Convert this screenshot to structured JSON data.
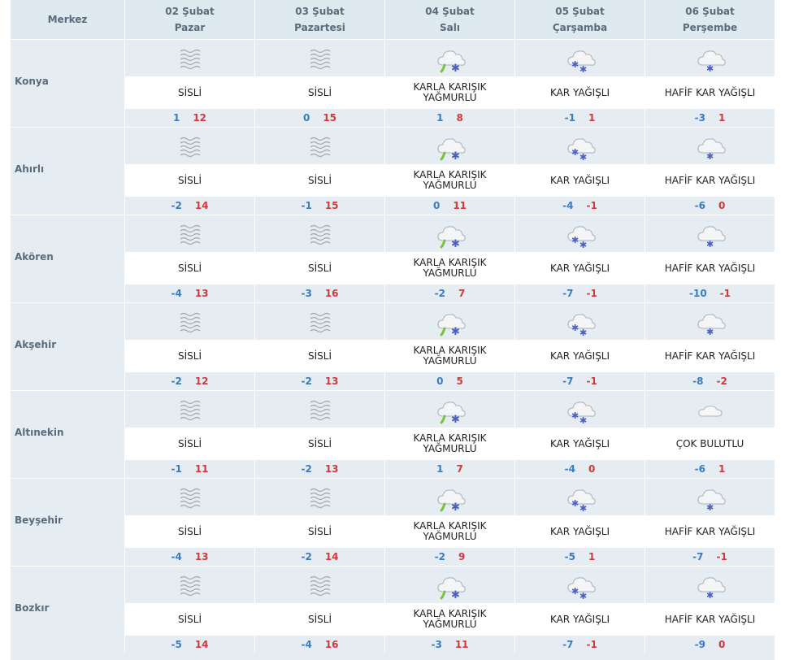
{
  "header": {
    "location_label": "Merkez",
    "days": [
      {
        "date": "02 Şubat",
        "weekday": "Pazar"
      },
      {
        "date": "03 Şubat",
        "weekday": "Pazartesi"
      },
      {
        "date": "04 Şubat",
        "weekday": "Salı"
      },
      {
        "date": "05 Şubat",
        "weekday": "Çarşamba"
      },
      {
        "date": "06 Şubat",
        "weekday": "Perşembe"
      }
    ]
  },
  "icon_colors": {
    "cloud": "#b9bec4",
    "fog": "#a9aeb4",
    "rain": "#7cc242",
    "snow": "#4b5fc4",
    "sun_bg": "#e5edf2"
  },
  "rows": [
    {
      "name": "Konya",
      "days": [
        {
          "icon": "fog-icon",
          "desc": "SİSLİ",
          "lo": "1",
          "hi": "12"
        },
        {
          "icon": "fog-icon",
          "desc": "SİSLİ",
          "lo": "0",
          "hi": "15"
        },
        {
          "icon": "sleet-icon",
          "desc": "KARLA KARIŞIK YAĞMURLU",
          "lo": "1",
          "hi": "8"
        },
        {
          "icon": "snow-icon",
          "desc": "KAR YAĞIŞLI",
          "lo": "-1",
          "hi": "1"
        },
        {
          "icon": "light-snow-icon",
          "desc": "HAFİF KAR YAĞIŞLI",
          "lo": "-3",
          "hi": "1"
        }
      ]
    },
    {
      "name": "Ahırlı",
      "days": [
        {
          "icon": "fog-icon",
          "desc": "SİSLİ",
          "lo": "-2",
          "hi": "14"
        },
        {
          "icon": "fog-icon",
          "desc": "SİSLİ",
          "lo": "-1",
          "hi": "15"
        },
        {
          "icon": "sleet-icon",
          "desc": "KARLA KARIŞIK YAĞMURLU",
          "lo": "0",
          "hi": "11"
        },
        {
          "icon": "snow-icon",
          "desc": "KAR YAĞIŞLI",
          "lo": "-4",
          "hi": "-1"
        },
        {
          "icon": "light-snow-icon",
          "desc": "HAFİF KAR YAĞIŞLI",
          "lo": "-6",
          "hi": "0"
        }
      ]
    },
    {
      "name": "Akören",
      "days": [
        {
          "icon": "fog-icon",
          "desc": "SİSLİ",
          "lo": "-4",
          "hi": "13"
        },
        {
          "icon": "fog-icon",
          "desc": "SİSLİ",
          "lo": "-3",
          "hi": "16"
        },
        {
          "icon": "sleet-icon",
          "desc": "KARLA KARIŞIK YAĞMURLU",
          "lo": "-2",
          "hi": "7"
        },
        {
          "icon": "snow-icon",
          "desc": "KAR YAĞIŞLI",
          "lo": "-7",
          "hi": "-1"
        },
        {
          "icon": "light-snow-icon",
          "desc": "HAFİF KAR YAĞIŞLI",
          "lo": "-10",
          "hi": "-1"
        }
      ]
    },
    {
      "name": "Akşehir",
      "days": [
        {
          "icon": "fog-icon",
          "desc": "SİSLİ",
          "lo": "-2",
          "hi": "12"
        },
        {
          "icon": "fog-icon",
          "desc": "SİSLİ",
          "lo": "-2",
          "hi": "13"
        },
        {
          "icon": "sleet-icon",
          "desc": "KARLA KARIŞIK YAĞMURLU",
          "lo": "0",
          "hi": "5"
        },
        {
          "icon": "snow-icon",
          "desc": "KAR YAĞIŞLI",
          "lo": "-7",
          "hi": "-1"
        },
        {
          "icon": "light-snow-icon",
          "desc": "HAFİF KAR YAĞIŞLI",
          "lo": "-8",
          "hi": "-2"
        }
      ]
    },
    {
      "name": "Altınekin",
      "days": [
        {
          "icon": "fog-icon",
          "desc": "SİSLİ",
          "lo": "-1",
          "hi": "11"
        },
        {
          "icon": "fog-icon",
          "desc": "SİSLİ",
          "lo": "-2",
          "hi": "13"
        },
        {
          "icon": "sleet-icon",
          "desc": "KARLA KARIŞIK YAĞMURLU",
          "lo": "1",
          "hi": "7"
        },
        {
          "icon": "snow-icon",
          "desc": "KAR YAĞIŞLI",
          "lo": "-4",
          "hi": "0"
        },
        {
          "icon": "cloudy-icon",
          "desc": "ÇOK BULUTLU",
          "lo": "-6",
          "hi": "1"
        }
      ]
    },
    {
      "name": "Beyşehir",
      "days": [
        {
          "icon": "fog-icon",
          "desc": "SİSLİ",
          "lo": "-4",
          "hi": "13"
        },
        {
          "icon": "fog-icon",
          "desc": "SİSLİ",
          "lo": "-2",
          "hi": "14"
        },
        {
          "icon": "sleet-icon",
          "desc": "KARLA KARIŞIK YAĞMURLU",
          "lo": "-2",
          "hi": "9"
        },
        {
          "icon": "snow-icon",
          "desc": "KAR YAĞIŞLI",
          "lo": "-5",
          "hi": "1"
        },
        {
          "icon": "light-snow-icon",
          "desc": "HAFİF KAR YAĞIŞLI",
          "lo": "-7",
          "hi": "-1"
        }
      ]
    },
    {
      "name": "Bozkır",
      "days": [
        {
          "icon": "fog-icon",
          "desc": "SİSLİ",
          "lo": "-5",
          "hi": "14"
        },
        {
          "icon": "fog-icon",
          "desc": "SİSLİ",
          "lo": "-4",
          "hi": "16"
        },
        {
          "icon": "sleet-icon",
          "desc": "KARLA KARIŞIK YAĞMURLU",
          "lo": "-3",
          "hi": "11"
        },
        {
          "icon": "snow-icon",
          "desc": "KAR YAĞIŞLI",
          "lo": "-7",
          "hi": "-1"
        },
        {
          "icon": "light-snow-icon",
          "desc": "HAFİF KAR YAĞIŞLI",
          "lo": "-9",
          "hi": "0"
        }
      ]
    }
  ]
}
